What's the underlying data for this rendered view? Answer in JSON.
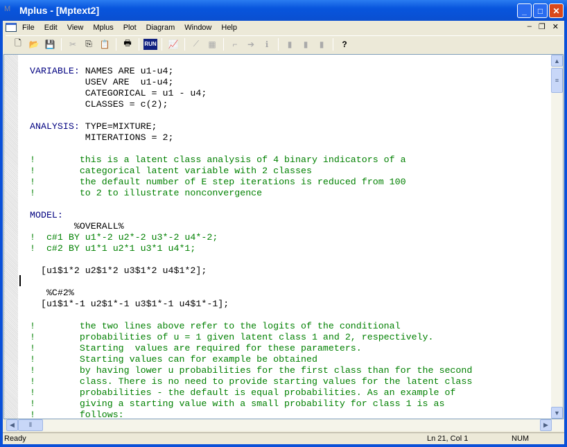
{
  "window": {
    "title": "Mplus - [Mptext2]",
    "app_icon": "mplus-logo-icon"
  },
  "menu": [
    "File",
    "Edit",
    "View",
    "Mplus",
    "Plot",
    "Diagram",
    "Window",
    "Help"
  ],
  "toolbar": {
    "run_label": "RUN",
    "help_label": "?"
  },
  "editor": {
    "lines": [
      [
        {
          "t": "VARIABLE: ",
          "c": "k"
        },
        {
          "t": "NAMES ARE u1-u4;",
          "c": "p"
        }
      ],
      [
        {
          "t": "          USEV ARE  u1-u4;",
          "c": "p"
        }
      ],
      [
        {
          "t": "          CATEGORICAL = u1 - u4;",
          "c": "p"
        }
      ],
      [
        {
          "t": "          CLASSES = c(2);",
          "c": "p"
        }
      ],
      [],
      [
        {
          "t": "ANALYSIS: ",
          "c": "k"
        },
        {
          "t": "TYPE=MIXTURE;",
          "c": "p"
        }
      ],
      [
        {
          "t": "          MITERATIONS = 2;",
          "c": "p"
        }
      ],
      [],
      [
        {
          "t": "!        this is a latent class analysis of 4 binary indicators of a",
          "c": "c"
        }
      ],
      [
        {
          "t": "!        categorical latent variable with 2 classes",
          "c": "c"
        }
      ],
      [
        {
          "t": "!        the default number of E step iterations is reduced from 100",
          "c": "c"
        }
      ],
      [
        {
          "t": "!        to 2 to illustrate nonconvergence",
          "c": "c"
        }
      ],
      [],
      [
        {
          "t": "MODEL:",
          "c": "k"
        }
      ],
      [
        {
          "t": "        %OVERALL%",
          "c": "p"
        }
      ],
      [
        {
          "t": "!  c#1 BY u1*-2 u2*-2 u3*-2 u4*-2;",
          "c": "c"
        }
      ],
      [
        {
          "t": "!  c#2 BY u1*1 u2*1 u3*1 u4*1;",
          "c": "c"
        }
      ],
      [],
      [
        {
          "t": "  [u1$1*2 u2$1*2 u3$1*2 u4$1*2];",
          "c": "p"
        }
      ],
      [],
      [
        {
          "t": "   %C#2%",
          "c": "p"
        }
      ],
      [
        {
          "t": "  [u1$1*-1 u2$1*-1 u3$1*-1 u4$1*-1];",
          "c": "p"
        }
      ],
      [],
      [
        {
          "t": "!        the two lines above refer to the logits of the conditional",
          "c": "c"
        }
      ],
      [
        {
          "t": "!        probabilities of u = 1 given latent class 1 and 2, respectively.",
          "c": "c"
        }
      ],
      [
        {
          "t": "!        Starting  values are required for these parameters.",
          "c": "c"
        }
      ],
      [
        {
          "t": "!        Starting values can for example be obtained",
          "c": "c"
        }
      ],
      [
        {
          "t": "!        by having lower u probabilities for the first class than for the second",
          "c": "c"
        }
      ],
      [
        {
          "t": "!        class. There is no need to provide starting values for the latent class",
          "c": "c"
        }
      ],
      [
        {
          "t": "!        probabilities - the default is equal probabilities. As an example of",
          "c": "c"
        }
      ],
      [
        {
          "t": "!        giving a starting value with a small probability for class 1 is as",
          "c": "c"
        }
      ],
      [
        {
          "t": "!        follows:",
          "c": "c"
        }
      ]
    ]
  },
  "status": {
    "text": "Ready",
    "position": "Ln 21, Col 1",
    "num": "NUM"
  },
  "colors": {
    "keyword": "#000080",
    "comment": "#008000",
    "titlebar": "#0a50d8"
  }
}
